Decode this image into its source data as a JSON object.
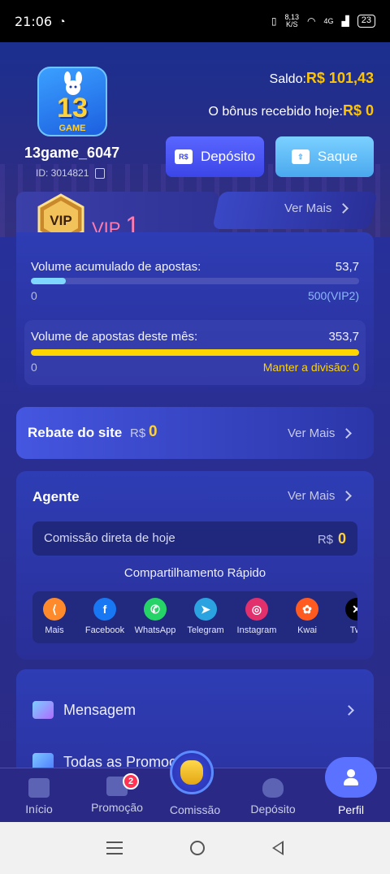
{
  "status_bar": {
    "time": "21:06",
    "speed_top": "8,13",
    "speed_unit": "K/S",
    "network": "4G",
    "battery": "23"
  },
  "profile": {
    "logo_number": "13",
    "logo_text": "GAME",
    "username": "13game_6047",
    "id_text": "ID: 3014821"
  },
  "balance": {
    "saldo_label": "Saldo:",
    "saldo_value": "R$ 101,43",
    "bonus_label": "O bônus recebido hoje:",
    "bonus_value": "R$ 0"
  },
  "actions": {
    "deposit_label": "Depósito",
    "withdraw_label": "Saque",
    "rs_icon_text": "R$"
  },
  "vip": {
    "badge_text": "VIP",
    "label": "VIP",
    "level": "1",
    "ver_mais": "Ver Mais",
    "acc_label": "Volume acumulado de apostas:",
    "acc_value": "53,7",
    "acc_min": "0",
    "acc_target": "500(VIP2)",
    "acc_progress": 0.107,
    "month_label": "Volume de apostas deste mês:",
    "month_value": "353,7",
    "month_min": "0",
    "month_target": "Manter a divisão: 0",
    "month_progress": 1.0,
    "accent": "#ffd400"
  },
  "rebate": {
    "title": "Rebate do site",
    "currency": "R$",
    "value": "0",
    "ver_mais": "Ver Mais"
  },
  "agent": {
    "title": "Agente",
    "ver_mais": "Ver Mais",
    "commission_label": "Comissão direta de hoje",
    "commission_currency": "R$",
    "commission_value": "0",
    "share_title": "Compartilhamento Rápido",
    "share_items": [
      {
        "label": "Mais",
        "icon": "share-icon",
        "color": "#ff8a2b"
      },
      {
        "label": "Facebook",
        "icon": "facebook-icon",
        "color": "#1877f2"
      },
      {
        "label": "WhatsApp",
        "icon": "whatsapp-icon",
        "color": "#25d366"
      },
      {
        "label": "Telegram",
        "icon": "telegram-icon",
        "color": "#2aa3e0"
      },
      {
        "label": "Instagram",
        "icon": "instagram-icon",
        "color": "#e1306c"
      },
      {
        "label": "Kwai",
        "icon": "kwai-icon",
        "color": "#ff5a1f"
      },
      {
        "label": "Twi",
        "icon": "x-icon",
        "color": "#000000"
      }
    ]
  },
  "menu": {
    "items": [
      {
        "label": "Mensagem",
        "icon": "mail-icon"
      },
      {
        "label": "Todas as Promoç",
        "icon": "gift-box-icon"
      }
    ]
  },
  "tabbar": {
    "tabs": [
      {
        "label": "Início",
        "icon": "home-icon"
      },
      {
        "label": "Promoção",
        "icon": "gift-icon",
        "badge": "2"
      },
      {
        "label": "Comissão",
        "icon": "money-bag-icon"
      },
      {
        "label": "Depósito",
        "icon": "coin-bag-icon"
      },
      {
        "label": "Perfil",
        "icon": "person-icon"
      }
    ],
    "active": "Perfil"
  }
}
